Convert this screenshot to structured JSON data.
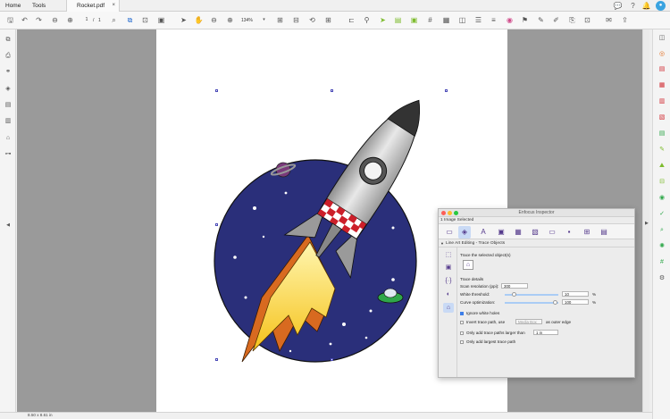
{
  "tabs": {
    "home": "Home",
    "tools": "Tools",
    "document": "Rocket.pdf",
    "close": "×"
  },
  "toolbar": {
    "page_current": "1",
    "page_sep": "/",
    "page_total": "1",
    "zoom": "134%"
  },
  "inspector": {
    "title": "Enfocus Inspector",
    "selection": "1 Image Selected",
    "section": "Line Art Editing - Trace Objects",
    "trace_heading": "Trace the selected object(s)",
    "details_heading": "Trace details",
    "scan_label": "Scan resolution (ppi):",
    "scan_value": "300",
    "white_label": "White threshold:",
    "white_value": "10",
    "white_unit": "%",
    "curve_label": "Curve optimization:",
    "curve_value": "100",
    "curve_unit": "%",
    "ignore_label": "Ignore white holes",
    "ignore_checked": true,
    "invert_label": "Invert trace path, use",
    "invert_select": "Media Box",
    "invert_suffix": "as outer edge",
    "only_larger_label": "Only add trace paths larger than",
    "only_larger_value": "1 in",
    "only_largest_label": "Only add largest trace path"
  },
  "status": {
    "dimensions": "8.50 x 8.61 in"
  },
  "colors": {
    "canvas": "#9a9a9a",
    "accent": "#3d7ee8",
    "tool_green": "#7dbb2d"
  }
}
